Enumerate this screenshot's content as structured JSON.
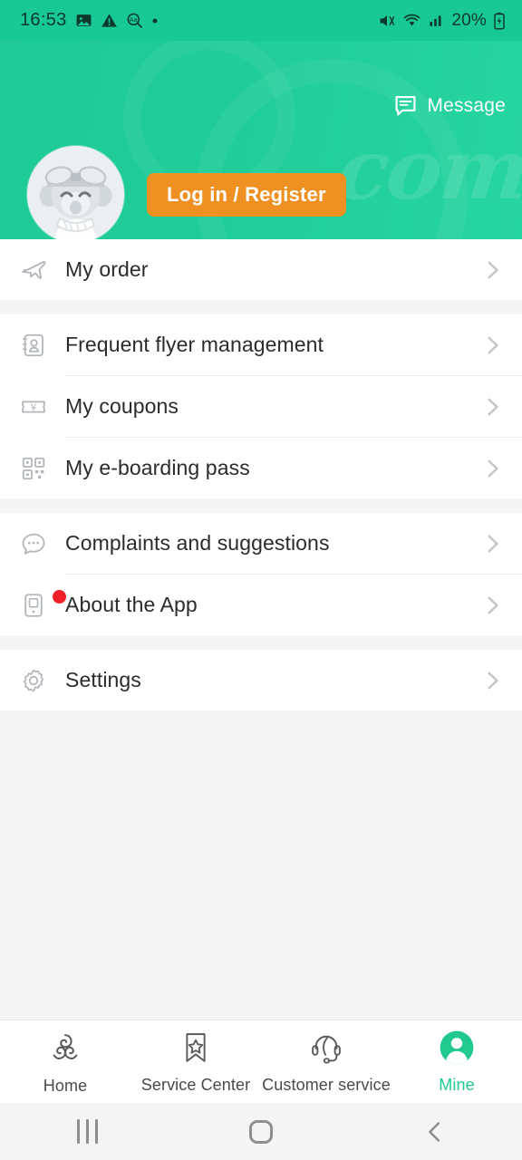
{
  "statusbar": {
    "time": "16:53",
    "icons_left": [
      "photo-icon",
      "warning-icon",
      "text-zoom-icon",
      "dot-icon"
    ],
    "icons_right": [
      "mute-icon",
      "wifi-icon",
      "signal-icon",
      "battery-icon"
    ],
    "battery_percent": "20%"
  },
  "header": {
    "message_label": "Message",
    "message_icon": "message-bubble-icon",
    "login_button": "Log in / Register",
    "avatar_icon": "default-user-avatar",
    "watermark": ".com",
    "bg_color": "#1ec995",
    "button_color": "#ef9122"
  },
  "menu": {
    "groups": [
      {
        "items": [
          {
            "label": "My order",
            "icon": "airplane-icon",
            "badge": false
          }
        ]
      },
      {
        "items": [
          {
            "label": "Frequent flyer management",
            "icon": "contact-card-icon",
            "badge": false
          },
          {
            "label": "My coupons",
            "icon": "coupon-ticket-icon",
            "badge": false
          },
          {
            "label": "My e-boarding pass",
            "icon": "qr-code-icon",
            "badge": false
          }
        ]
      },
      {
        "items": [
          {
            "label": "Complaints and suggestions",
            "icon": "chat-bubble-icon",
            "badge": false
          },
          {
            "label": "About the App",
            "icon": "mobile-device-icon",
            "badge": true
          }
        ]
      },
      {
        "items": [
          {
            "label": "Settings",
            "icon": "gear-icon",
            "badge": false
          }
        ]
      }
    ],
    "chevron_icon": "chevron-right-icon",
    "badge_color": "#f01f28"
  },
  "tabbar": {
    "active_color": "#22c98e",
    "tabs": [
      {
        "label": "Home",
        "icon": "triskelion-logo-icon",
        "active": false
      },
      {
        "label": "Service Center",
        "icon": "bookmark-star-icon",
        "active": false
      },
      {
        "label": "Customer service",
        "icon": "headset-icon",
        "active": false
      },
      {
        "label": "Mine",
        "icon": "user-profile-icon",
        "active": true
      }
    ]
  },
  "sysnav": {
    "recents": "recents-icon",
    "home": "home-icon",
    "back": "back-icon"
  }
}
